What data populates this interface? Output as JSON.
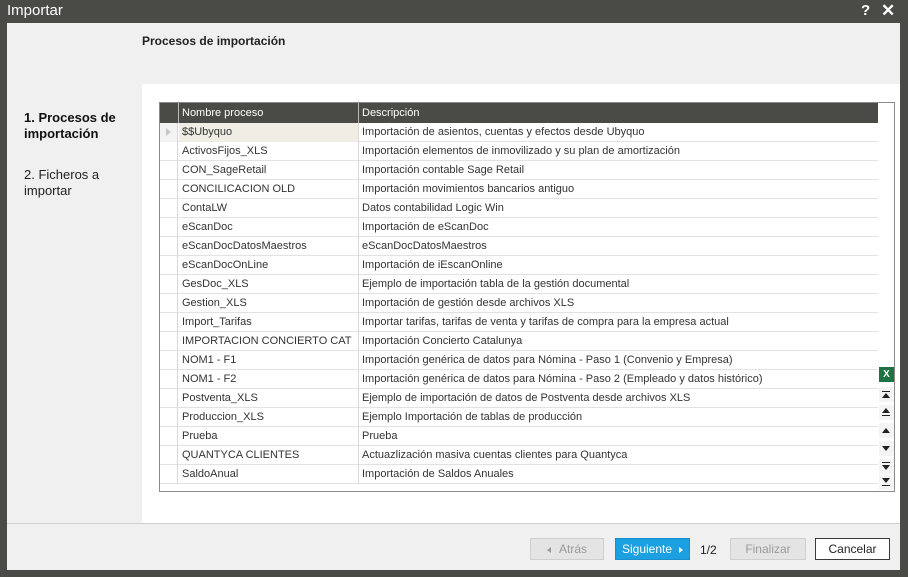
{
  "window": {
    "title": "Importar",
    "help": "?",
    "close": "✕"
  },
  "header": {
    "title": "Procesos de importación"
  },
  "steps": [
    {
      "label": "1. Procesos de importación",
      "active": true
    },
    {
      "label": "2. Ficheros a importar",
      "active": false
    }
  ],
  "grid": {
    "columns": [
      "Nombre proceso",
      "Descripción"
    ],
    "rows": [
      {
        "name": "$$Ubyquo",
        "desc": "Importación de asientos, cuentas y efectos desde Ubyquo"
      },
      {
        "name": "ActivosFijos_XLS",
        "desc": "Importación elementos de inmovilizado y su plan de amortización"
      },
      {
        "name": "CON_SageRetail",
        "desc": "Importación contable Sage Retail"
      },
      {
        "name": "CONCILICACION OLD",
        "desc": "Importación movimientos bancarios antiguo"
      },
      {
        "name": "ContaLW",
        "desc": "Datos contabilidad Logic Win"
      },
      {
        "name": "eScanDoc",
        "desc": "Importación de eScanDoc"
      },
      {
        "name": "eScanDocDatosMaestros",
        "desc": "eScanDocDatosMaestros"
      },
      {
        "name": "eScanDocOnLine",
        "desc": "Importación de iEscanOnline"
      },
      {
        "name": "GesDoc_XLS",
        "desc": "Ejemplo de importación tabla de la gestión documental"
      },
      {
        "name": "Gestion_XLS",
        "desc": "Importación de gestión desde archivos XLS"
      },
      {
        "name": "Import_Tarifas",
        "desc": "Importar tarifas, tarifas de venta y tarifas de compra para la empresa actual"
      },
      {
        "name": "IMPORTACION CONCIERTO CAT",
        "desc": "Importación Concierto Catalunya"
      },
      {
        "name": "NOM1 - F1",
        "desc": "Importación genérica de datos para Nómina - Paso 1 (Convenio y Empresa)"
      },
      {
        "name": "NOM1 - F2",
        "desc": "Importación genérica de datos para Nómina - Paso 2 (Empleado y datos histórico)"
      },
      {
        "name": "Postventa_XLS",
        "desc": "Ejemplo de importación de datos de Postventa desde archivos XLS"
      },
      {
        "name": "Produccion_XLS",
        "desc": "Ejemplo Importación de tablas de producción"
      },
      {
        "name": "Prueba",
        "desc": "Prueba"
      },
      {
        "name": "QUANTYCA CLIENTES",
        "desc": "Actuazlización masiva cuentas clientes para Quantyca"
      },
      {
        "name": "SaldoAnual",
        "desc": "Importación de Saldos Anuales"
      }
    ],
    "excel_icon": "X"
  },
  "footer": {
    "back_label": "Atrás",
    "next_label": "Siguiente",
    "page_indicator": "1/2",
    "finish_label": "Finalizar",
    "cancel_label": "Cancelar"
  },
  "colors": {
    "accent": "#1ba1e2",
    "titlebar": "#4a4a46",
    "excel": "#1f7244"
  }
}
